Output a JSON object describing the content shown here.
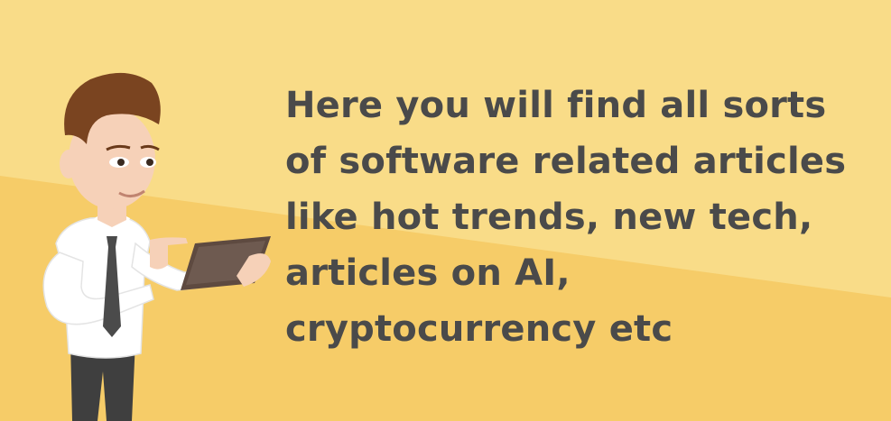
{
  "colors": {
    "background_light": "#F9DC88",
    "background_dark": "#F6CC68",
    "text": "#4A4A4A",
    "hair": "#7A4420",
    "skin": "#F6D1B8",
    "shirt": "#FFFFFF",
    "tie": "#4B4B4B",
    "tablet": "#5E4A40",
    "trousers": "#3F3F3F"
  },
  "headline": {
    "lines": [
      "Here you will find all sorts",
      "of software related articles",
      "like hot trends, new tech,",
      "articles on AI,",
      "cryptocurrency etc"
    ]
  },
  "illustration": {
    "subject": "man-holding-tablet",
    "icon": "man-with-tablet-icon"
  }
}
